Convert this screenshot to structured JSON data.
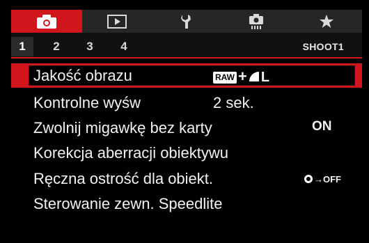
{
  "tabs": [
    {
      "icon": "camera-icon",
      "active": true
    },
    {
      "icon": "playback-icon",
      "active": false
    },
    {
      "icon": "wrench-icon",
      "active": false
    },
    {
      "icon": "custom-functions-icon",
      "active": false
    },
    {
      "icon": "star-icon",
      "active": false
    }
  ],
  "subtabs": [
    "1",
    "2",
    "3",
    "4"
  ],
  "active_subtab": "1",
  "section_label": "SHOOT1",
  "menu": {
    "items": [
      {
        "label": "Jakość obrazu",
        "value_raw": "RAW",
        "value_plus": "+",
        "value_L": "L"
      },
      {
        "label": "Kontrolne wyśw",
        "value": "2 sek."
      },
      {
        "label": "Zwolnij migawkę bez karty",
        "value": "ON"
      },
      {
        "label": "Korekcja aberracji obiektywu"
      },
      {
        "label": "Ręczna ostrość dla obiekt.",
        "value": "→OFF"
      },
      {
        "label": "Sterowanie zewn. Speedlite"
      }
    ]
  },
  "colors": {
    "accent": "#d0151d",
    "background": "#000000",
    "tabbar": "#262626"
  }
}
